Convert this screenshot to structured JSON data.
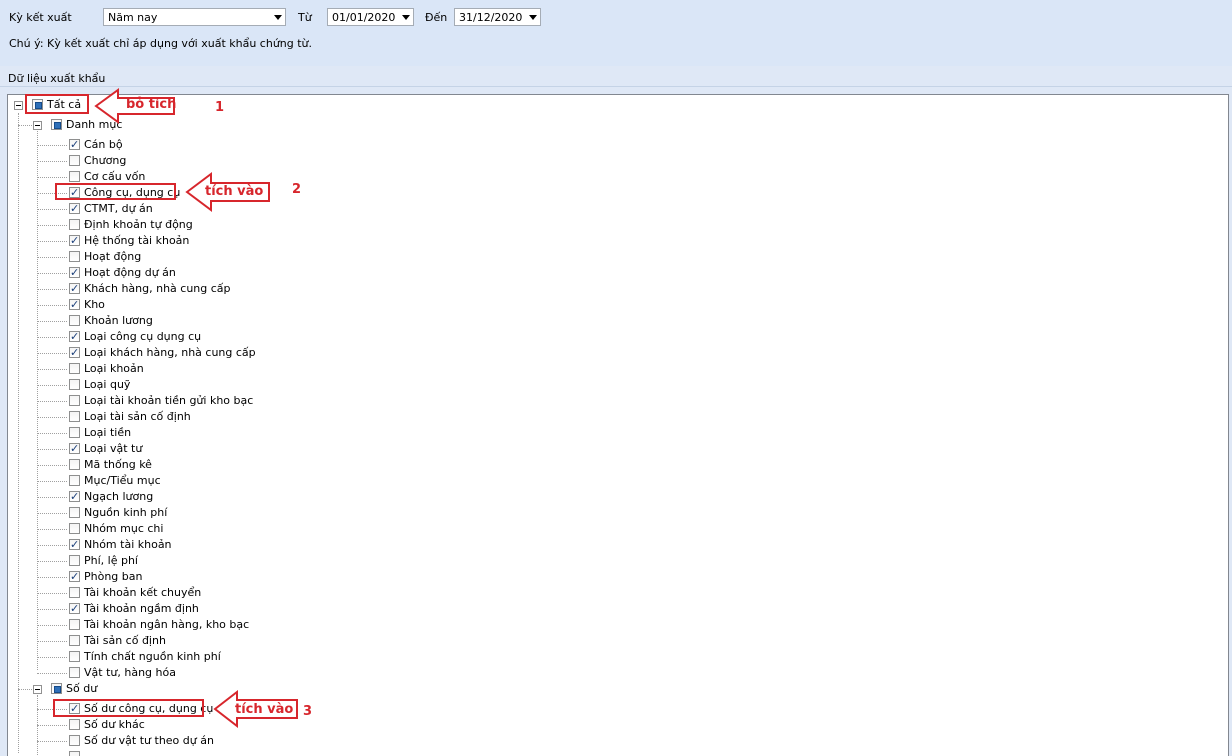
{
  "filter": {
    "period_label": "Kỳ kết xuất",
    "period_value": "Năm nay",
    "from_label": "Từ",
    "from_value": "01/01/2020",
    "to_label": "Đến",
    "to_value": "31/12/2020",
    "note": "Chú ý: Kỳ kết xuất chỉ áp dụng với xuất khẩu chứng từ."
  },
  "section_title": "Dữ liệu xuất khẩu",
  "tree": {
    "root": {
      "label": "Tất cả",
      "state": "partial"
    },
    "danh_muc": {
      "label": "Danh mục",
      "state": "partial",
      "items": [
        {
          "label": "Cán bộ",
          "checked": true
        },
        {
          "label": "Chương",
          "checked": false
        },
        {
          "label": "Cơ cấu vốn",
          "checked": false
        },
        {
          "label": "Công cụ, dụng cụ",
          "checked": true
        },
        {
          "label": "CTMT, dự án",
          "checked": true
        },
        {
          "label": "Định khoản tự động",
          "checked": false
        },
        {
          "label": "Hệ thống tài khoản",
          "checked": true
        },
        {
          "label": "Hoạt động",
          "checked": false
        },
        {
          "label": "Hoạt động dự án",
          "checked": true
        },
        {
          "label": "Khách hàng, nhà cung cấp",
          "checked": true
        },
        {
          "label": "Kho",
          "checked": true
        },
        {
          "label": "Khoản lương",
          "checked": false
        },
        {
          "label": "Loại công cụ dụng cụ",
          "checked": true
        },
        {
          "label": "Loại khách hàng, nhà cung cấp",
          "checked": true
        },
        {
          "label": "Loại khoản",
          "checked": false
        },
        {
          "label": "Loại quỹ",
          "checked": false
        },
        {
          "label": "Loại tài khoản tiền gửi kho bạc",
          "checked": false
        },
        {
          "label": "Loại tài sản cố định",
          "checked": false
        },
        {
          "label": "Loại tiền",
          "checked": false
        },
        {
          "label": "Loại vật tư",
          "checked": true
        },
        {
          "label": "Mã thống kê",
          "checked": false
        },
        {
          "label": "Mục/Tiểu mục",
          "checked": false
        },
        {
          "label": "Ngạch lương",
          "checked": true
        },
        {
          "label": "Nguồn kinh phí",
          "checked": false
        },
        {
          "label": "Nhóm mục chi",
          "checked": false
        },
        {
          "label": "Nhóm tài khoản",
          "checked": true
        },
        {
          "label": "Phí, lệ phí",
          "checked": false
        },
        {
          "label": "Phòng ban",
          "checked": true
        },
        {
          "label": "Tài khoản kết chuyển",
          "checked": false
        },
        {
          "label": "Tài khoản ngầm định",
          "checked": true
        },
        {
          "label": "Tài khoản ngân hàng, kho bạc",
          "checked": false
        },
        {
          "label": "Tài sản cố định",
          "checked": false
        },
        {
          "label": "Tính chất nguồn kinh phí",
          "checked": false
        },
        {
          "label": "Vật tư, hàng hóa",
          "checked": false
        }
      ]
    },
    "so_du": {
      "label": "Số dư",
      "state": "partial",
      "items": [
        {
          "label": "Số dư công cụ, dụng cụ",
          "checked": true
        },
        {
          "label": "Số dư khác",
          "checked": false
        },
        {
          "label": "Số dư vật tư theo dự án",
          "checked": false
        },
        {
          "label": "",
          "checked": false
        }
      ]
    }
  },
  "annotations": {
    "a1_text": "bỏ tích",
    "a1_num": "1",
    "a2_text": "tích vào",
    "a2_num": "2",
    "a3_text": "tích vào",
    "a3_num": "3",
    "color": "#d7262c"
  }
}
